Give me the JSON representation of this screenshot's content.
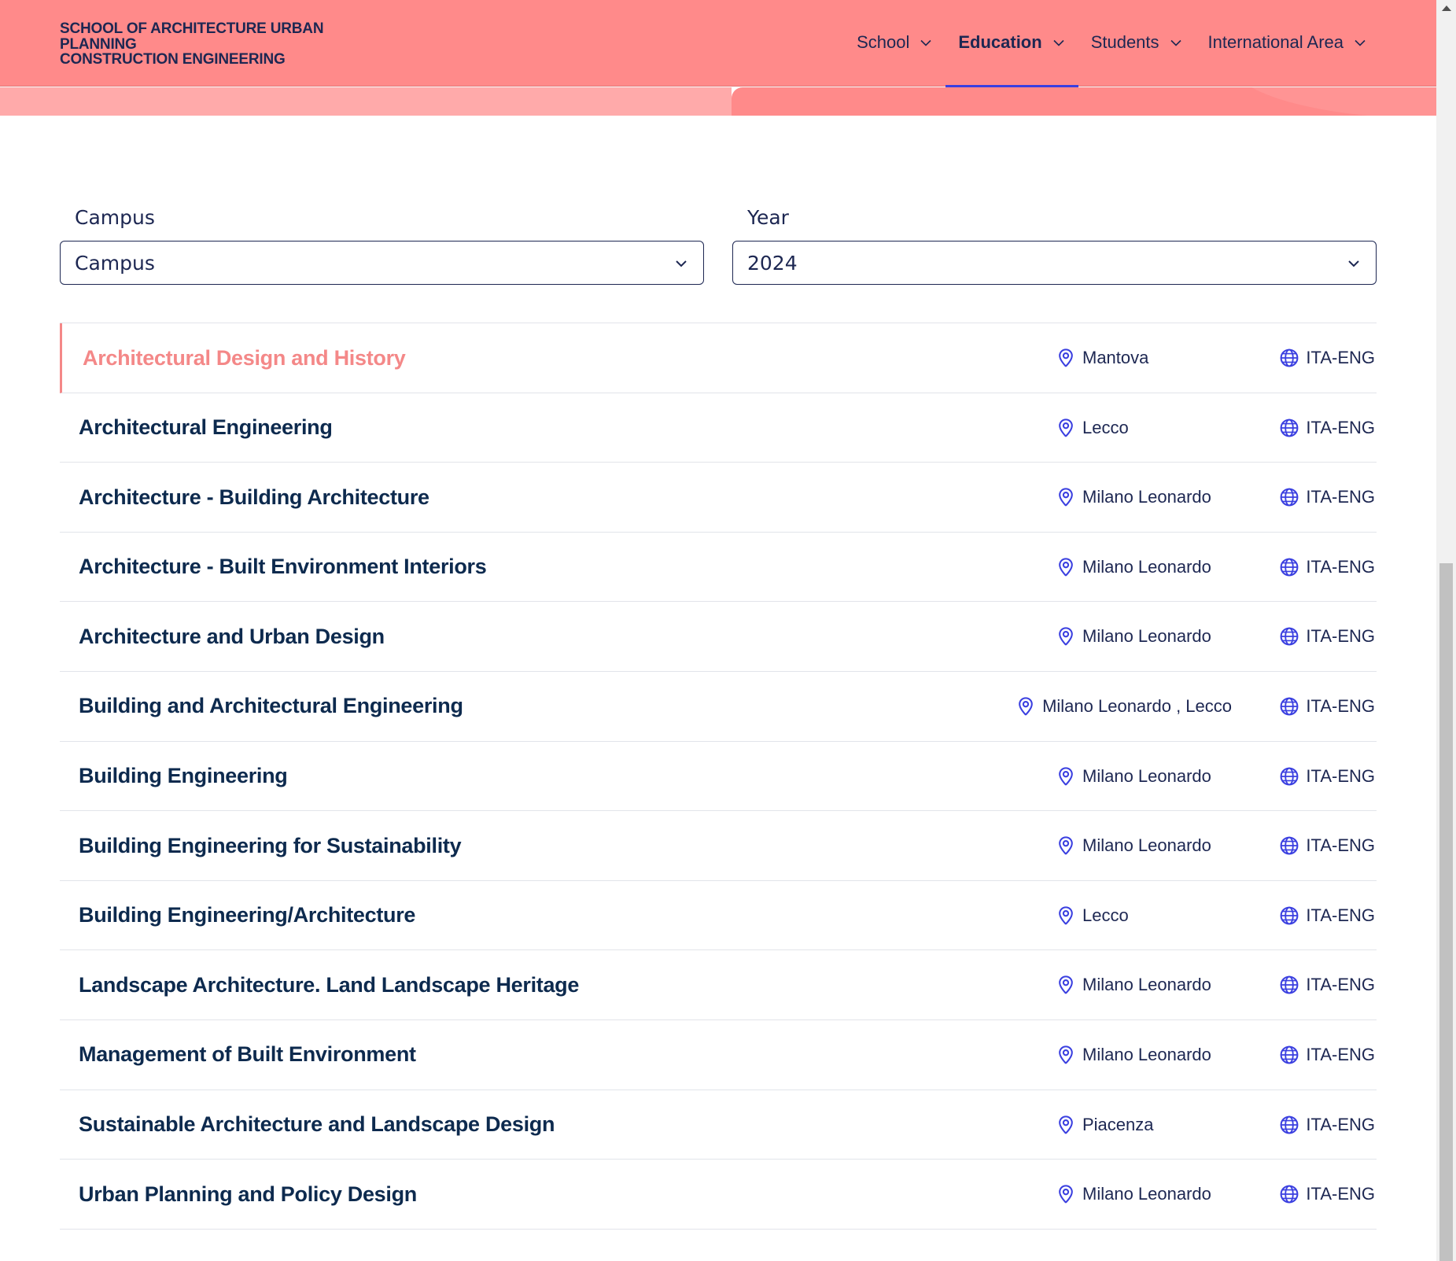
{
  "header": {
    "logo_lines": [
      "SCHOOL OF ARCHITECTURE URBAN",
      "PLANNING",
      "CONSTRUCTION ENGINEERING"
    ],
    "nav": [
      {
        "label": "School",
        "active": false
      },
      {
        "label": "Education",
        "active": true
      },
      {
        "label": "Students",
        "active": false
      },
      {
        "label": "International Area",
        "active": false
      }
    ]
  },
  "filters": {
    "campus": {
      "label": "Campus",
      "value": "Campus"
    },
    "year": {
      "label": "Year",
      "value": "2024"
    }
  },
  "colors": {
    "header_bg": "#ff8a8a",
    "accent": "#3a3fe0",
    "active_course": "#f48888",
    "text_dark": "#0d2a4e"
  },
  "icons": {
    "campus": "location-pin-icon",
    "language": "globe-icon",
    "dropdown": "chevron-down-icon"
  },
  "courses": [
    {
      "title": "Architectural Design and History",
      "campus": "Mantova",
      "language": "ITA-ENG",
      "active": true
    },
    {
      "title": "Architectural Engineering",
      "campus": "Lecco",
      "language": "ITA-ENG"
    },
    {
      "title": "Architecture - Building Architecture",
      "campus": "Milano Leonardo",
      "language": "ITA-ENG"
    },
    {
      "title": "Architecture - Built Environment Interiors",
      "campus": "Milano Leonardo",
      "language": "ITA-ENG"
    },
    {
      "title": "Architecture and Urban Design",
      "campus": "Milano Leonardo",
      "language": "ITA-ENG"
    },
    {
      "title": "Building and Architectural Engineering",
      "campus": "Milano Leonardo , Lecco",
      "language": "ITA-ENG"
    },
    {
      "title": "Building Engineering",
      "campus": "Milano Leonardo",
      "language": "ITA-ENG"
    },
    {
      "title": "Building Engineering for Sustainability",
      "campus": "Milano Leonardo",
      "language": "ITA-ENG"
    },
    {
      "title": "Building Engineering/Architecture",
      "campus": "Lecco",
      "language": "ITA-ENG"
    },
    {
      "title": "Landscape Architecture. Land Landscape Heritage",
      "campus": "Milano Leonardo",
      "language": "ITA-ENG"
    },
    {
      "title": "Management of Built Environment",
      "campus": "Milano Leonardo",
      "language": "ITA-ENG"
    },
    {
      "title": "Sustainable Architecture and Landscape Design",
      "campus": "Piacenza",
      "language": "ITA-ENG"
    },
    {
      "title": "Urban Planning and Policy Design",
      "campus": "Milano Leonardo",
      "language": "ITA-ENG"
    }
  ]
}
